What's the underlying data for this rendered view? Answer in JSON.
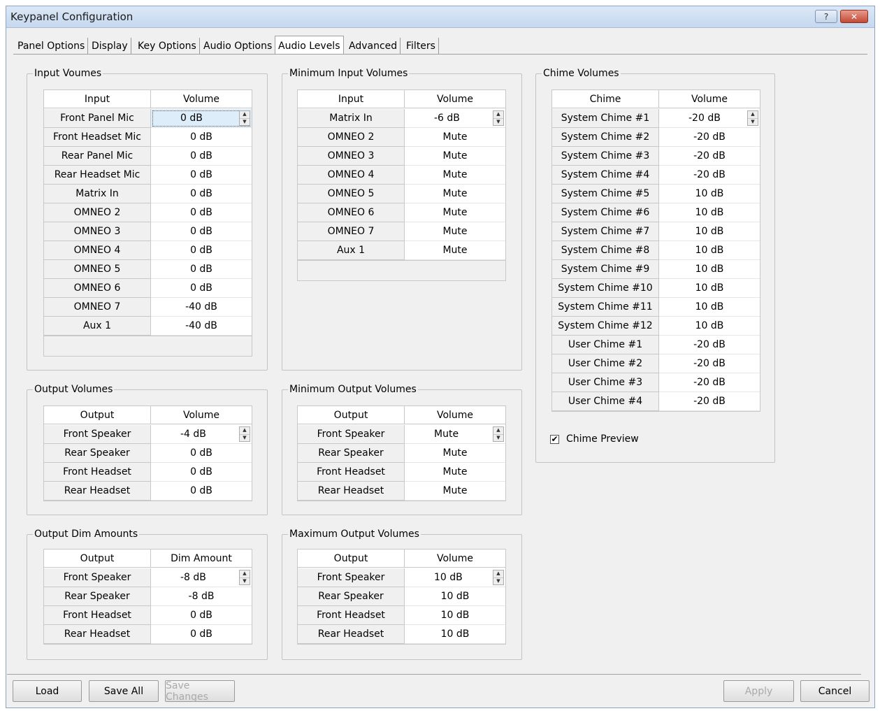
{
  "window": {
    "title": "Keypanel Configuration",
    "help_label": "?",
    "close_label": "✕"
  },
  "tabs": [
    "Panel Options",
    "Display",
    "Key Options",
    "Audio Options",
    "Audio Levels",
    "Advanced",
    "Filters"
  ],
  "active_tab": "Audio Levels",
  "groups": {
    "input_volumes": {
      "legend": "Input Voumes",
      "headers": [
        "Input",
        "Volume"
      ],
      "rows": [
        {
          "label": "Front Panel Mic",
          "value": "0 dB"
        },
        {
          "label": "Front Headset Mic",
          "value": "0 dB"
        },
        {
          "label": "Rear Panel Mic",
          "value": "0 dB"
        },
        {
          "label": "Rear Headset Mic",
          "value": "0 dB"
        },
        {
          "label": "Matrix In",
          "value": "0 dB"
        },
        {
          "label": "OMNEO 2",
          "value": "0 dB"
        },
        {
          "label": "OMNEO 3",
          "value": "0 dB"
        },
        {
          "label": "OMNEO 4",
          "value": "0 dB"
        },
        {
          "label": "OMNEO 5",
          "value": "0 dB"
        },
        {
          "label": "OMNEO 6",
          "value": "0 dB"
        },
        {
          "label": "OMNEO 7",
          "value": "-40 dB"
        },
        {
          "label": "Aux 1",
          "value": "-40 dB"
        }
      ]
    },
    "min_input_volumes": {
      "legend": "Minimum Input Volumes",
      "headers": [
        "Input",
        "Volume"
      ],
      "rows": [
        {
          "label": "Matrix In",
          "value": "-6 dB"
        },
        {
          "label": "OMNEO 2",
          "value": "Mute"
        },
        {
          "label": "OMNEO 3",
          "value": "Mute"
        },
        {
          "label": "OMNEO 4",
          "value": "Mute"
        },
        {
          "label": "OMNEO 5",
          "value": "Mute"
        },
        {
          "label": "OMNEO 6",
          "value": "Mute"
        },
        {
          "label": "OMNEO 7",
          "value": "Mute"
        },
        {
          "label": "Aux 1",
          "value": "Mute"
        }
      ]
    },
    "chime_volumes": {
      "legend": "Chime Volumes",
      "headers": [
        "Chime",
        "Volume"
      ],
      "rows": [
        {
          "label": "System Chime #1",
          "value": "-20 dB"
        },
        {
          "label": "System Chime #2",
          "value": "-20 dB"
        },
        {
          "label": "System Chime #3",
          "value": "-20 dB"
        },
        {
          "label": "System Chime #4",
          "value": "-20 dB"
        },
        {
          "label": "System Chime #5",
          "value": "10 dB"
        },
        {
          "label": "System Chime #6",
          "value": "10 dB"
        },
        {
          "label": "System Chime #7",
          "value": "10 dB"
        },
        {
          "label": "System Chime #8",
          "value": "10 dB"
        },
        {
          "label": "System Chime #9",
          "value": "10 dB"
        },
        {
          "label": "System Chime #10",
          "value": "10 dB"
        },
        {
          "label": "System Chime #11",
          "value": "10 dB"
        },
        {
          "label": "System Chime #12",
          "value": "10 dB"
        },
        {
          "label": "User Chime #1",
          "value": "-20 dB"
        },
        {
          "label": "User Chime #2",
          "value": "-20 dB"
        },
        {
          "label": "User Chime #3",
          "value": "-20 dB"
        },
        {
          "label": "User Chime #4",
          "value": "-20 dB"
        }
      ],
      "preview_label": "Chime Preview",
      "preview_checked": true
    },
    "output_volumes": {
      "legend": "Output Volumes",
      "headers": [
        "Output",
        "Volume"
      ],
      "rows": [
        {
          "label": "Front Speaker",
          "value": "-4 dB"
        },
        {
          "label": "Rear Speaker",
          "value": "0 dB"
        },
        {
          "label": "Front Headset",
          "value": "0 dB"
        },
        {
          "label": "Rear Headset",
          "value": "0 dB"
        }
      ]
    },
    "min_output_volumes": {
      "legend": "Minimum Output Volumes",
      "headers": [
        "Output",
        "Volume"
      ],
      "rows": [
        {
          "label": "Front Speaker",
          "value": "Mute"
        },
        {
          "label": "Rear Speaker",
          "value": "Mute"
        },
        {
          "label": "Front Headset",
          "value": "Mute"
        },
        {
          "label": "Rear Headset",
          "value": "Mute"
        }
      ]
    },
    "output_dim_amounts": {
      "legend": "Output Dim Amounts",
      "headers": [
        "Output",
        "Dim Amount"
      ],
      "rows": [
        {
          "label": "Front Speaker",
          "value": "-8 dB"
        },
        {
          "label": "Rear Speaker",
          "value": "-8 dB"
        },
        {
          "label": "Front Headset",
          "value": "0 dB"
        },
        {
          "label": "Rear Headset",
          "value": "0 dB"
        }
      ]
    },
    "max_output_volumes": {
      "legend": "Maximum Output Volumes",
      "headers": [
        "Output",
        "Volume"
      ],
      "rows": [
        {
          "label": "Front Speaker",
          "value": "10 dB"
        },
        {
          "label": "Rear Speaker",
          "value": "10 dB"
        },
        {
          "label": "Front Headset",
          "value": "10 dB"
        },
        {
          "label": "Rear Headset",
          "value": "10 dB"
        }
      ]
    }
  },
  "buttons": {
    "load": "Load",
    "save_all": "Save All",
    "save_changes": "Save Changes",
    "apply": "Apply",
    "cancel": "Cancel"
  },
  "spin_glyphs": {
    "up": "▲",
    "down": "▼"
  },
  "check_glyph": "✔"
}
